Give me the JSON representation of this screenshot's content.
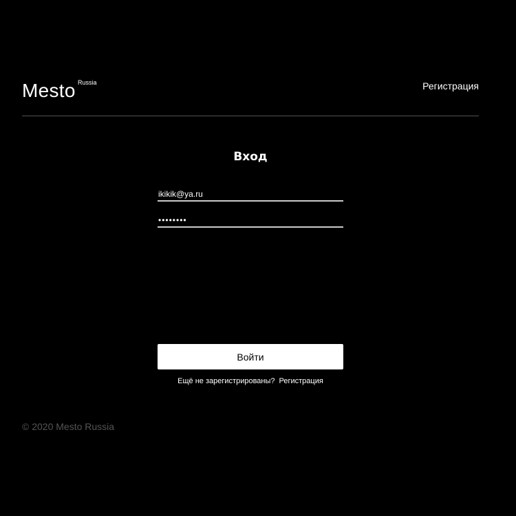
{
  "header": {
    "logo": "Mesto",
    "logo_sup": "Russia",
    "register_link": "Регистрация"
  },
  "login": {
    "title": "Вход",
    "email_value": "ikikik@ya.ru",
    "password_value": "••••••••",
    "submit_label": "Войти",
    "not_registered_text": "Ещё не зарегистрированы?",
    "register_link": "Регистрация"
  },
  "footer": {
    "copyright": "© 2020 Mesto Russia"
  },
  "colors": {
    "background": "#000000",
    "text": "#ffffff",
    "divider": "#545454",
    "footer_text": "#545454",
    "button_bg": "#ffffff",
    "button_text": "#000000"
  }
}
